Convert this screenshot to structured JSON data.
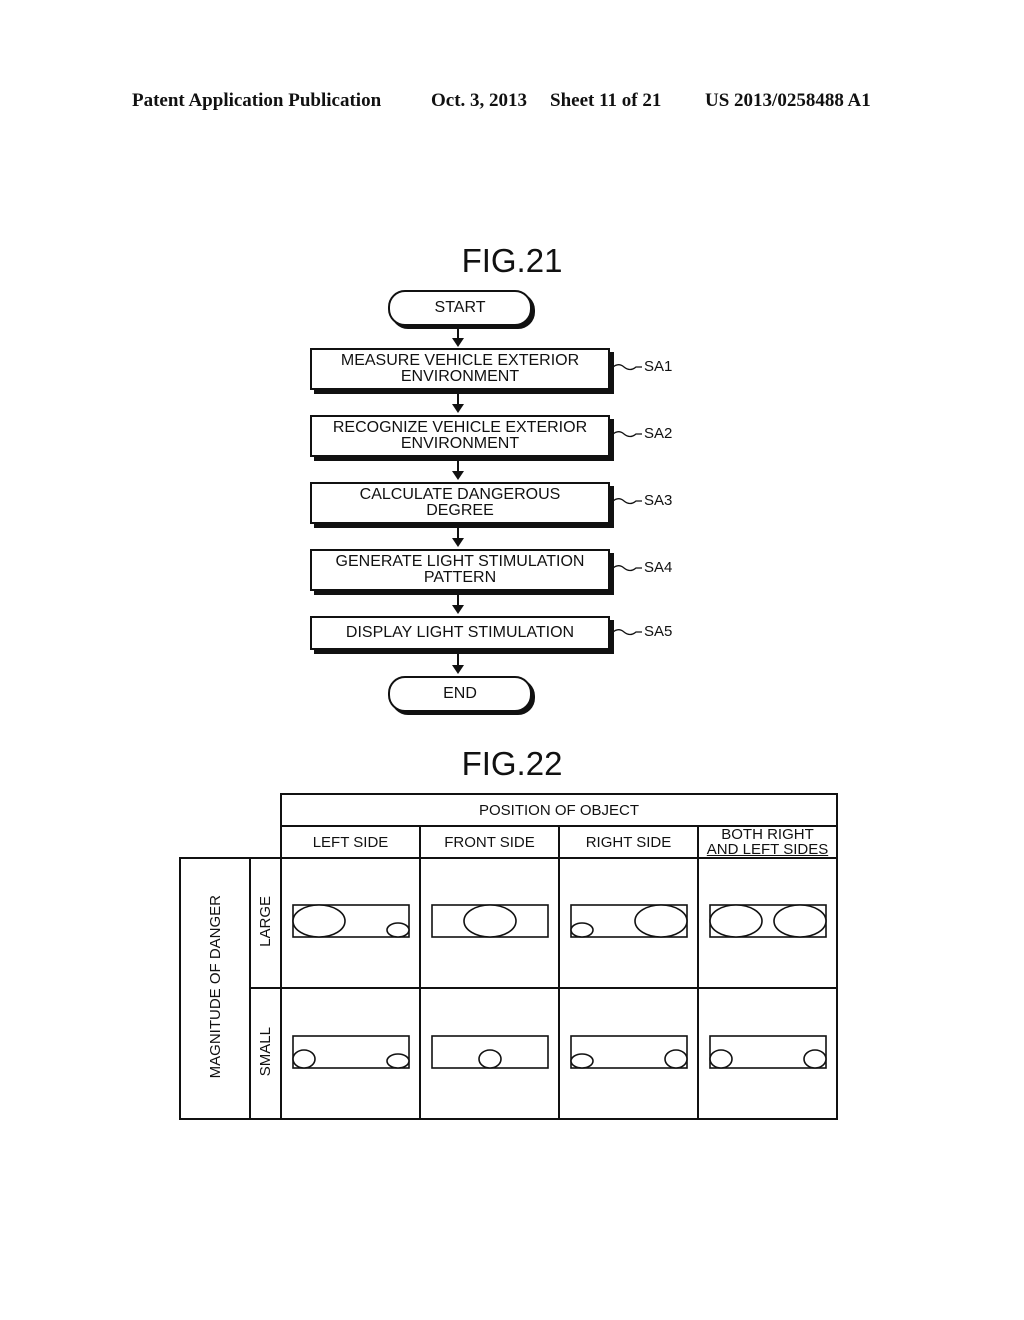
{
  "header": {
    "publication": "Patent Application Publication",
    "date": "Oct. 3, 2013",
    "sheet": "Sheet 11 of 21",
    "number": "US 2013/0258488 A1"
  },
  "fig21": {
    "title": "FIG.21",
    "start": "START",
    "end": "END",
    "steps": [
      {
        "id": "SA1",
        "line1": "MEASURE VEHICLE EXTERIOR",
        "line2": "ENVIRONMENT"
      },
      {
        "id": "SA2",
        "line1": "RECOGNIZE VEHICLE EXTERIOR",
        "line2": "ENVIRONMENT"
      },
      {
        "id": "SA3",
        "line1": "CALCULATE DANGEROUS",
        "line2": "DEGREE"
      },
      {
        "id": "SA4",
        "line1": "GENERATE LIGHT STIMULATION",
        "line2": "PATTERN"
      },
      {
        "id": "SA5",
        "line1": "DISPLAY LIGHT STIMULATION",
        "line2": ""
      }
    ]
  },
  "fig22": {
    "title": "FIG.22",
    "col_group_header": "POSITION OF OBJECT",
    "columns": [
      "LEFT SIDE",
      "FRONT SIDE",
      "RIGHT SIDE",
      "BOTH RIGHT",
      "AND LEFT SIDES"
    ],
    "row_group_header": "MAGNITUDE OF DANGER",
    "rows": [
      "LARGE",
      "SMALL"
    ],
    "patterns": {
      "large": [
        [
          {
            "pos": "left",
            "size": "large"
          },
          {
            "pos": "right",
            "size": "small"
          }
        ],
        [
          {
            "pos": "center",
            "size": "large"
          }
        ],
        [
          {
            "pos": "left",
            "size": "small"
          },
          {
            "pos": "right",
            "size": "large"
          }
        ],
        [
          {
            "pos": "left",
            "size": "large"
          },
          {
            "pos": "right",
            "size": "large"
          }
        ]
      ],
      "small": [
        [
          {
            "pos": "left",
            "size": "medium"
          },
          {
            "pos": "right",
            "size": "small"
          }
        ],
        [
          {
            "pos": "center",
            "size": "medium"
          }
        ],
        [
          {
            "pos": "left",
            "size": "small"
          },
          {
            "pos": "right",
            "size": "medium"
          }
        ],
        [
          {
            "pos": "left",
            "size": "medium"
          },
          {
            "pos": "right",
            "size": "medium"
          }
        ]
      ]
    }
  }
}
